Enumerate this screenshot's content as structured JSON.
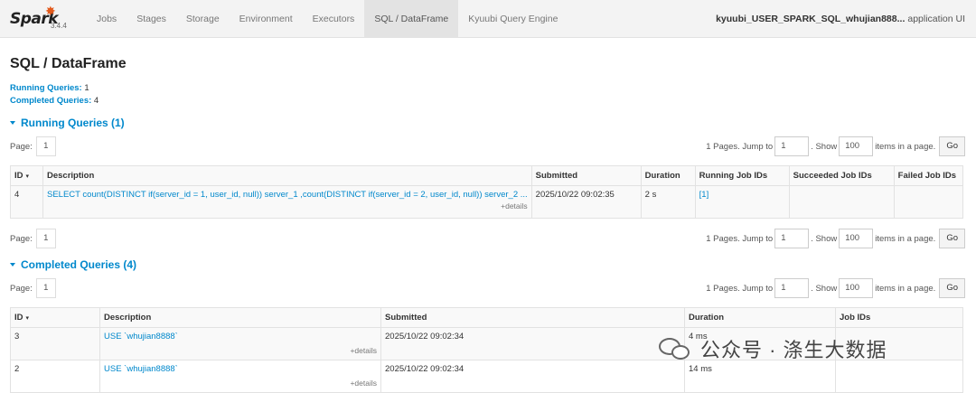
{
  "navbar": {
    "logo": "Spark",
    "version": "3.4.4",
    "tabs": [
      "Jobs",
      "Stages",
      "Storage",
      "Environment",
      "Executors",
      "SQL / DataFrame",
      "Kyuubi Query Engine"
    ],
    "app_name": "kyuubi_USER_SPARK_SQL_whujian888...",
    "app_suffix": "application UI"
  },
  "page_title": "SQL / DataFrame",
  "summary": {
    "running_label": "Running Queries:",
    "running_count": "1",
    "completed_label": "Completed Queries:",
    "completed_count": "4"
  },
  "running_section": {
    "title": "Running Queries (1)",
    "pager": {
      "page_label": "Page:",
      "page": "1",
      "pages_text": "1 Pages. Jump to",
      "jump": "1",
      "show_label": ". Show",
      "show": "100",
      "items_text": "items in a page.",
      "go": "Go"
    },
    "columns": [
      "ID",
      "Description",
      "Submitted",
      "Duration",
      "Running Job IDs",
      "Succeeded Job IDs",
      "Failed Job IDs"
    ],
    "rows": [
      {
        "id": "4",
        "description": "SELECT count(DISTINCT if(server_id = 1, user_id, null)) server_1 ,count(DISTINCT if(server_id = 2, user_id, null)) server_2 ...",
        "details": "+details",
        "submitted": "2025/10/22 09:02:35",
        "duration": "2 s",
        "running_jobs": "[1]",
        "succeeded_jobs": "",
        "failed_jobs": ""
      }
    ]
  },
  "completed_section": {
    "title": "Completed Queries (4)",
    "pager": {
      "page_label": "Page:",
      "page": "1",
      "pages_text": "1 Pages. Jump to",
      "jump": "1",
      "show_label": ". Show",
      "show": "100",
      "items_text": "items in a page.",
      "go": "Go"
    },
    "columns": [
      "ID",
      "Description",
      "Submitted",
      "Duration",
      "Job IDs"
    ],
    "rows": [
      {
        "id": "3",
        "description": "USE `whujian8888`",
        "details": "+details",
        "submitted": "2025/10/22 09:02:34",
        "duration": "4 ms",
        "job_ids": ""
      },
      {
        "id": "2",
        "description": "USE `whujian8888`",
        "details": "+details",
        "submitted": "2025/10/22 09:02:34",
        "duration": "14 ms",
        "job_ids": ""
      }
    ]
  },
  "watermark": "公众号 · 涤生大数据",
  "colors": {
    "link": "#0088cc",
    "logo_accent": "#e25a1c",
    "navbar_bg": "#f3f3f3"
  },
  "sort_indicator": "▾"
}
